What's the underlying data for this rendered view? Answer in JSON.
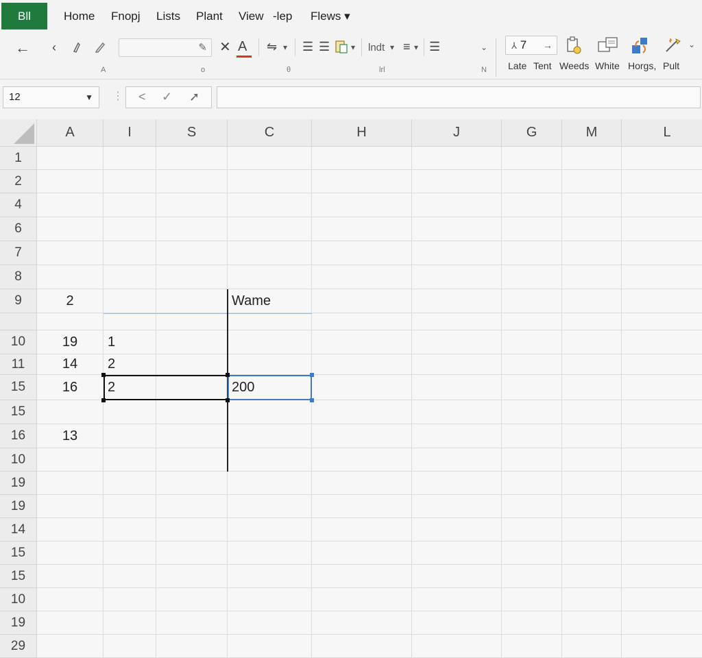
{
  "menubar": {
    "app_label": "Bll",
    "menus": [
      "Home",
      "Fnopj",
      "Lists",
      "Plant",
      "View",
      "-lep",
      "Flews ▾"
    ]
  },
  "ribbon": {
    "group_labels": [
      "A",
      "o",
      "θ",
      "lrl",
      "N"
    ],
    "font_color_letter": "A",
    "indent_label": "lndt",
    "command_box_value": "7",
    "big_buttons": [
      "Late",
      "Tent",
      "Weeds",
      "White",
      "Horgs,",
      "Pult"
    ]
  },
  "formula_bar": {
    "name_box_value": "12",
    "formula_value": ""
  },
  "grid": {
    "columns": [
      "A",
      "I",
      "S",
      "C",
      "H",
      "J",
      "G",
      "M",
      "L"
    ],
    "rows": [
      "1",
      "2",
      "4",
      "6",
      "7",
      "8",
      "9",
      "",
      "10",
      "11",
      "15",
      "15",
      "16",
      "10",
      "19",
      "19",
      "14",
      "15",
      "15",
      "10",
      "19",
      "29"
    ],
    "cells": [
      {
        "row": 6,
        "col": 0,
        "value": "2"
      },
      {
        "row": 6,
        "col": 3,
        "value": "Wame"
      },
      {
        "row": 8,
        "col": 0,
        "value": "19"
      },
      {
        "row": 8,
        "col": 1,
        "value": "1"
      },
      {
        "row": 9,
        "col": 0,
        "value": "14"
      },
      {
        "row": 9,
        "col": 1,
        "value": "2"
      },
      {
        "row": 10,
        "col": 0,
        "value": "16"
      },
      {
        "row": 10,
        "col": 1,
        "value": "2"
      },
      {
        "row": 10,
        "col": 3,
        "value": "200"
      },
      {
        "row": 12,
        "col": 0,
        "value": "13"
      }
    ]
  },
  "colors": {
    "app_green": "#1e7a3d",
    "selection_blue": "#3d7bc6",
    "font_color_red": "#d9312b"
  }
}
